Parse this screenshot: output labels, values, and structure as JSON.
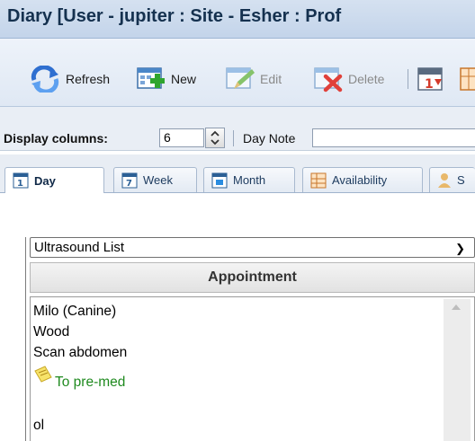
{
  "window": {
    "title": "Diary [User - jupiter : Site - Esher : Prof"
  },
  "toolbar": {
    "refresh": "Refresh",
    "new": "New",
    "edit": "Edit",
    "delete": "Delete",
    "calendar_day": "1"
  },
  "fields": {
    "display_columns_label": "Display columns:",
    "display_columns_value": "6",
    "day_note_label": "Day Note",
    "day_note_value": ""
  },
  "tabs": [
    {
      "label": "Day",
      "active": true,
      "icon_text": "1"
    },
    {
      "label": "Week",
      "icon_text": "7"
    },
    {
      "label": "Month"
    },
    {
      "label": "Availability"
    },
    {
      "label": "S"
    }
  ],
  "list_select": {
    "value": "Ultrasound List"
  },
  "grid": {
    "header": "Appointment",
    "appointment": {
      "patient": "Milo (Canine)",
      "owner": "Wood",
      "procedure": "Scan abdomen",
      "note": "To pre-med",
      "extra": "ol"
    }
  },
  "colors": {
    "note_text": "#1f8a1f",
    "title_text": "#15314f"
  }
}
